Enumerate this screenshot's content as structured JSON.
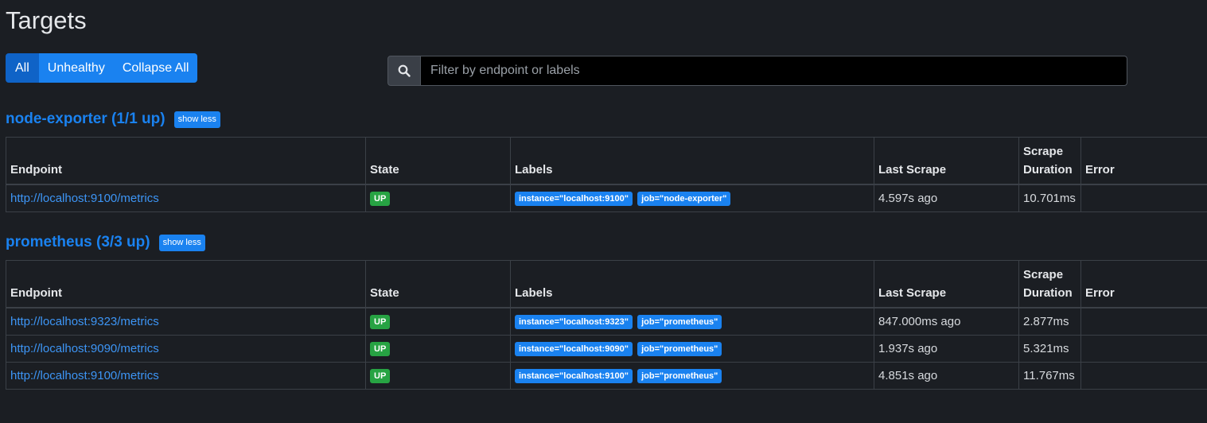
{
  "page": {
    "title": "Targets"
  },
  "filters": {
    "all_label": "All",
    "unhealthy_label": "Unhealthy",
    "collapse_label": "Collapse All"
  },
  "search": {
    "placeholder": "Filter by endpoint or labels",
    "value": ""
  },
  "columns": {
    "endpoint": "Endpoint",
    "state": "State",
    "labels": "Labels",
    "last_scrape": "Last Scrape",
    "scrape_duration": "Scrape Duration",
    "error": "Error"
  },
  "pools": [
    {
      "title": "node-exporter (1/1 up)",
      "toggle_label": "show less",
      "targets": [
        {
          "endpoint": "http://localhost:9100/metrics",
          "state": "UP",
          "labels": [
            "instance=\"localhost:9100\"",
            "job=\"node-exporter\""
          ],
          "last_scrape": "4.597s ago",
          "duration": "10.701ms",
          "error": ""
        }
      ]
    },
    {
      "title": "prometheus (3/3 up)",
      "toggle_label": "show less",
      "targets": [
        {
          "endpoint": "http://localhost:9323/metrics",
          "state": "UP",
          "labels": [
            "instance=\"localhost:9323\"",
            "job=\"prometheus\""
          ],
          "last_scrape": "847.000ms ago",
          "duration": "2.877ms",
          "error": ""
        },
        {
          "endpoint": "http://localhost:9090/metrics",
          "state": "UP",
          "labels": [
            "instance=\"localhost:9090\"",
            "job=\"prometheus\""
          ],
          "last_scrape": "1.937s ago",
          "duration": "5.321ms",
          "error": ""
        },
        {
          "endpoint": "http://localhost:9100/metrics",
          "state": "UP",
          "labels": [
            "instance=\"localhost:9100\"",
            "job=\"prometheus\""
          ],
          "last_scrape": "4.851s ago",
          "duration": "11.767ms",
          "error": ""
        }
      ]
    }
  ],
  "colors": {
    "background": "#1b1e23",
    "accent": "#1a82f0",
    "up": "#27a343"
  },
  "icons": {
    "search": "search-icon"
  }
}
